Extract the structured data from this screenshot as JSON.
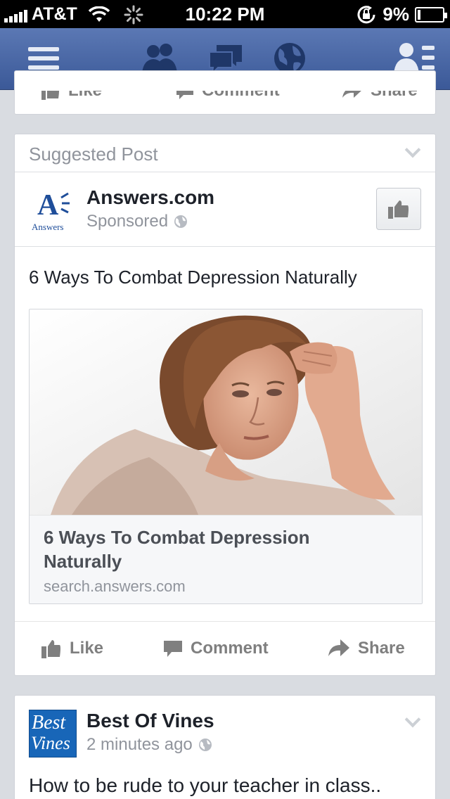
{
  "status_bar": {
    "carrier": "AT&T",
    "time": "10:22 PM",
    "battery": "9%",
    "battery_level": 0.09
  },
  "nav": {
    "icons": [
      "menu-icon",
      "friend-requests-icon",
      "messages-icon",
      "notifications-globe-icon",
      "contacts-icon"
    ]
  },
  "prev_post": {
    "actions": {
      "like": "Like",
      "comment": "Comment",
      "share": "Share"
    }
  },
  "suggested_post": {
    "header": "Suggested Post",
    "advertiser": {
      "name": "Answers.com",
      "logo_text": "Answers",
      "sponsored_label": "Sponsored"
    },
    "message": "6 Ways To Combat Depression Naturally",
    "link": {
      "title": "6 Ways To Combat Depression Naturally",
      "domain": "search.answers.com"
    },
    "actions": {
      "like": "Like",
      "comment": "Comment",
      "share": "Share"
    }
  },
  "next_post": {
    "page_name": "Best Of Vines",
    "logo_line1": "Best",
    "logo_line2": "Vines",
    "timestamp": "2 minutes ago",
    "message": "How to be rude to your teacher in class.."
  },
  "colors": {
    "fb_blue": "#3b5998",
    "nav_top": "#5b78b4",
    "feed_bg": "#d9dce1",
    "answers_blue": "#1f4e9a",
    "vines_blue": "#1866b8"
  }
}
